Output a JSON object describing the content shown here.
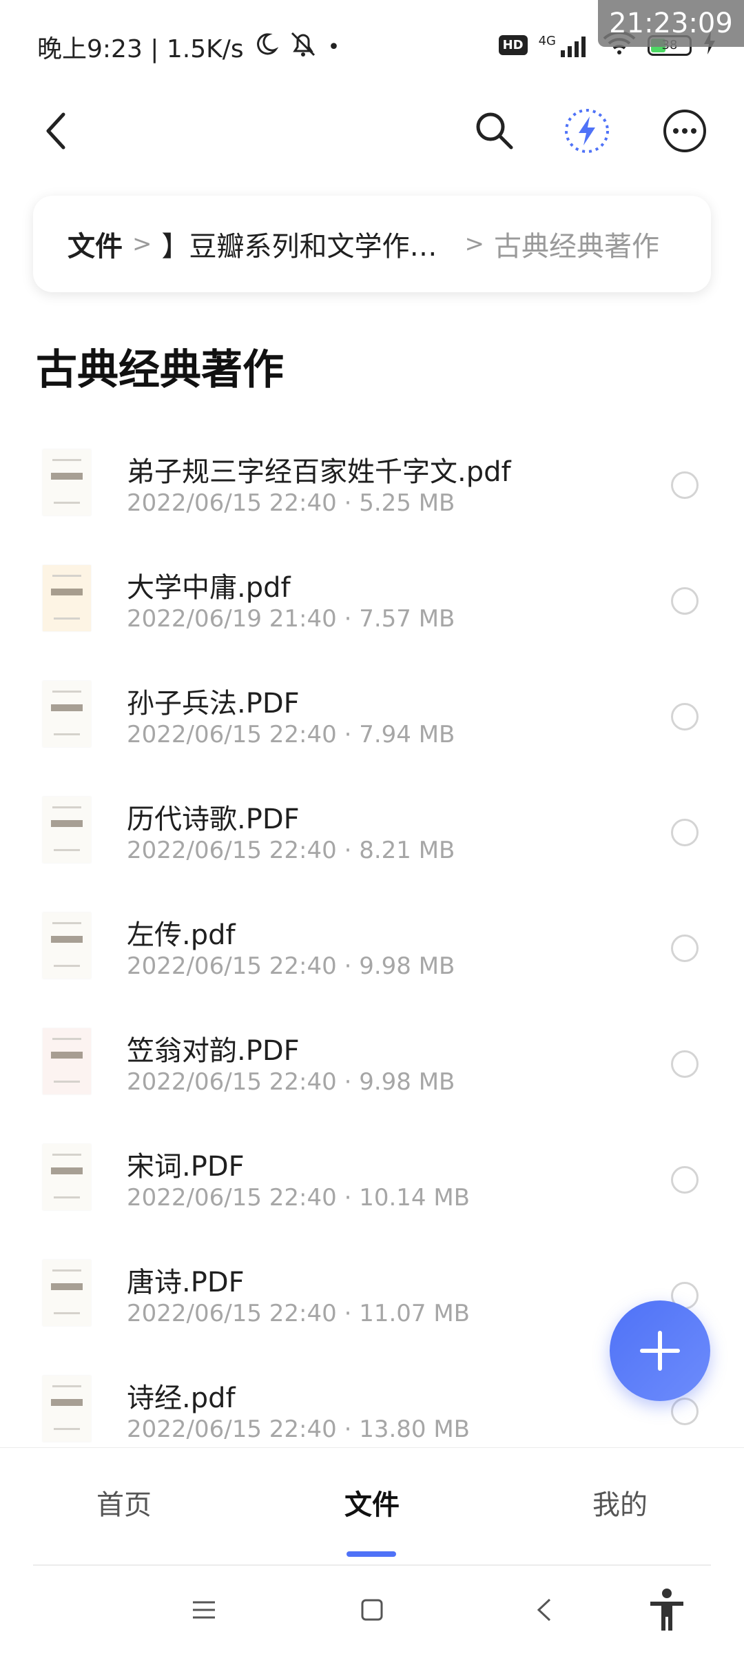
{
  "status_bar": {
    "time_network": "晚上9:23 | 1.5K/s",
    "hd_badge": "HD",
    "network_type": "4G",
    "battery_level": "38",
    "overlay_clock": "21:23:09"
  },
  "breadcrumb": {
    "root": "文件",
    "middle": "】豆瓣系列和文学作…",
    "current": "古典经典著作"
  },
  "page_title": "古典经典著作",
  "files": [
    {
      "name": "弟子规三字经百家姓千字文.pdf",
      "date": "2022/06/15 22:40",
      "size": "5.25 MB"
    },
    {
      "name": "大学中庸.pdf",
      "date": "2022/06/19 21:40",
      "size": "7.57 MB"
    },
    {
      "name": "孙子兵法.PDF",
      "date": "2022/06/15 22:40",
      "size": "7.94 MB"
    },
    {
      "name": "历代诗歌.PDF",
      "date": "2022/06/15 22:40",
      "size": "8.21 MB"
    },
    {
      "name": "左传.pdf",
      "date": "2022/06/15 22:40",
      "size": "9.98 MB"
    },
    {
      "name": "笠翁对韵.PDF",
      "date": "2022/06/15 22:40",
      "size": "9.98 MB"
    },
    {
      "name": "宋词.PDF",
      "date": "2022/06/15 22:40",
      "size": "10.14 MB"
    },
    {
      "name": "唐诗.PDF",
      "date": "2022/06/15 22:40",
      "size": "11.07 MB"
    },
    {
      "name": "诗经.pdf",
      "date": "2022/06/15 22:40",
      "size": "13.80 MB"
    }
  ],
  "meta_separator": "·",
  "bottom_nav": {
    "home": "首页",
    "files": "文件",
    "mine": "我的"
  },
  "colors": {
    "accent": "#4f72f7",
    "secondary_text": "#a6a6a6"
  }
}
